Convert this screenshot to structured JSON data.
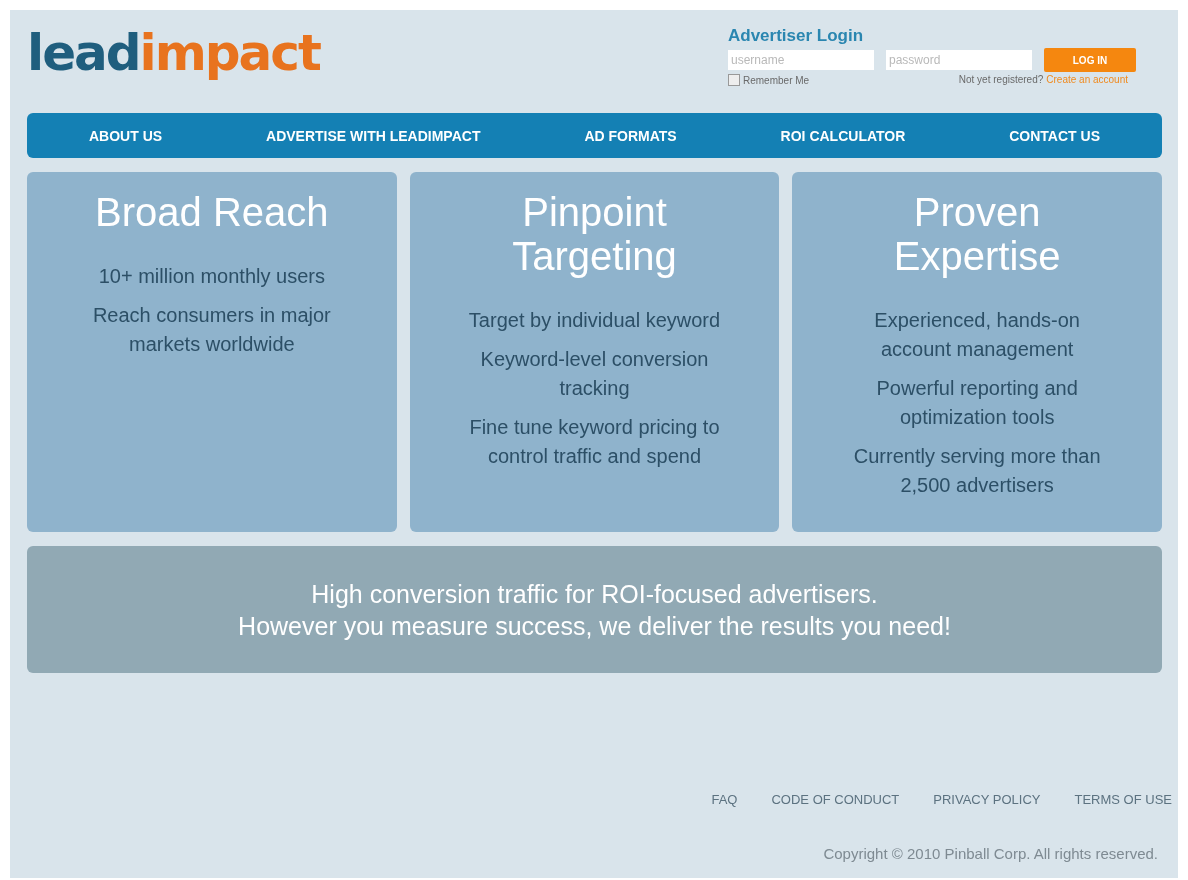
{
  "logo": {
    "part_1": "lead",
    "part_2": "impact"
  },
  "login": {
    "title": "Advertiser Login",
    "username": {
      "placeholder": "username"
    },
    "password": {
      "placeholder": "password"
    },
    "button": "LOG IN",
    "remember": {
      "label": "Remember Me",
      "checked": false
    },
    "register_text": "Not yet registered?",
    "register_link": "Create an account"
  },
  "nav": [
    "ABOUT US",
    "ADVERTISE WITH LEADIMPACT",
    "AD FORMATS",
    "ROI CALCULATOR",
    "CONTACT US"
  ],
  "cards": [
    {
      "title": "Broad Reach",
      "points": [
        "10+ million monthly users",
        "Reach consumers in major markets worldwide"
      ]
    },
    {
      "title": "Pinpoint Targeting",
      "points": [
        "Target by individual keyword",
        "Keyword-level conversion tracking",
        "Fine tune keyword pricing to control traffic and spend"
      ]
    },
    {
      "title": "Proven Expertise",
      "points": [
        "Experienced, hands-on account management",
        "Powerful reporting and optimization tools",
        "Currently serving more than 2,500 advertisers"
      ]
    }
  ],
  "banner": [
    "High conversion traffic for ROI-focused advertisers.",
    "However you measure success, we deliver the results you need!"
  ],
  "footer_links": [
    "FAQ",
    "CODE OF CONDUCT",
    "PRIVACY POLICY",
    "TERMS OF USE"
  ],
  "copyright": "Copyright © 2010 Pinball Corp. All rights reserved."
}
